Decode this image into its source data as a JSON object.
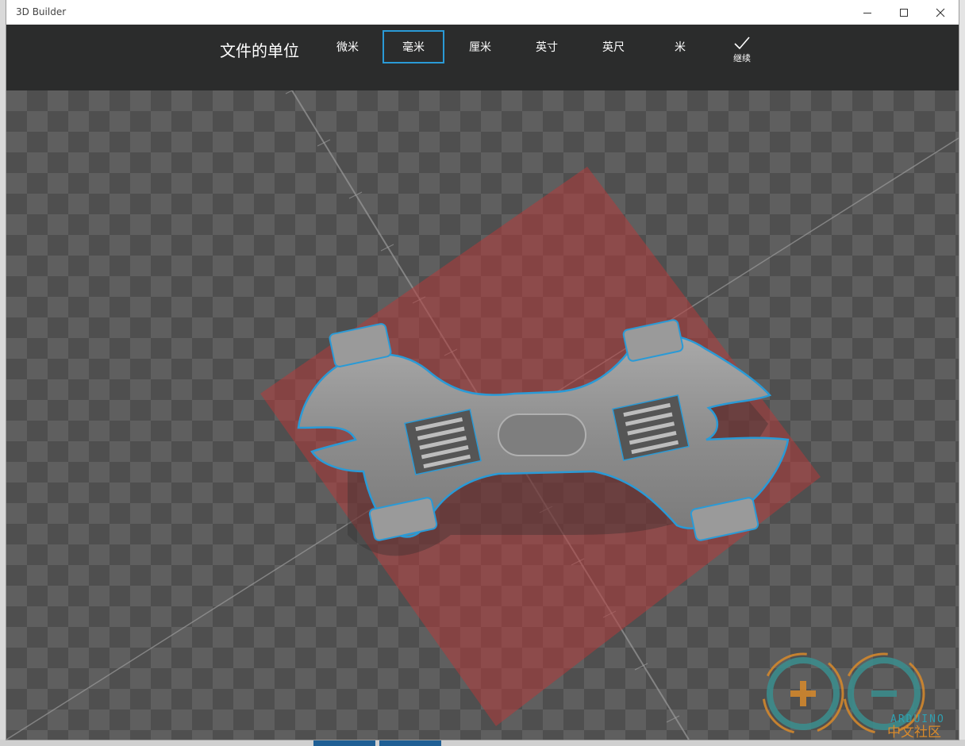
{
  "window": {
    "title": "3D Builder"
  },
  "toolbar": {
    "label": "文件的单位",
    "units": [
      {
        "label": "微米",
        "selected": false
      },
      {
        "label": "毫米",
        "selected": true
      },
      {
        "label": "厘米",
        "selected": false
      },
      {
        "label": "英寸",
        "selected": false
      },
      {
        "label": "英尺",
        "selected": false
      },
      {
        "label": "米",
        "selected": false
      }
    ],
    "continue_label": "继续"
  },
  "watermark": {
    "brand": "ARDUINO",
    "sub": "中文社区"
  },
  "colors": {
    "accent": "#2a9ad6",
    "toolbar_bg": "#2b2c2c",
    "build_plate": "#b33a3a",
    "model": "#8e8e8e"
  }
}
